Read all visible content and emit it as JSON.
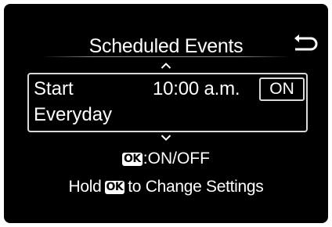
{
  "screen": {
    "title": "Scheduled Events",
    "back_icon": "return-arrow-icon"
  },
  "event": {
    "label": "Start",
    "time": "10:00 a.m.",
    "toggle": "ON",
    "repeat": "Everyday"
  },
  "help": {
    "ok_badge": "OK",
    "toggle_hint": ":ON/OFF",
    "hold_prefix": "Hold",
    "hold_suffix": "to Change Settings"
  },
  "colors": {
    "background": "#000000",
    "text": "#ffffff",
    "border": "#d9d9d9"
  }
}
